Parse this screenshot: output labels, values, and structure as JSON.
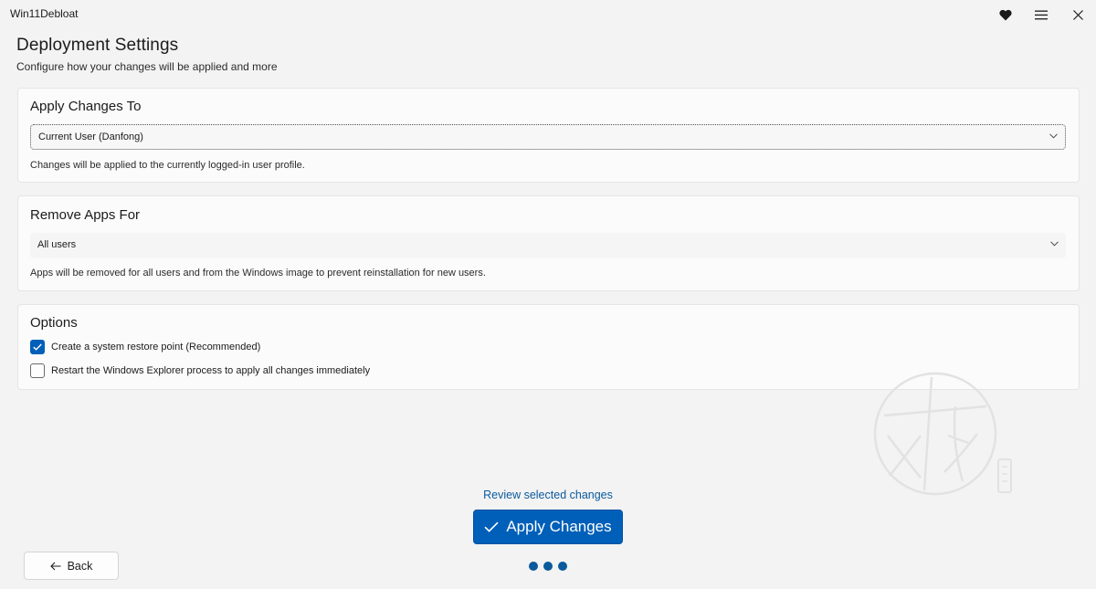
{
  "window": {
    "title": "Win11Debloat"
  },
  "titlebar": {
    "icons": [
      "heart-icon",
      "menu-icon",
      "close-icon"
    ]
  },
  "header": {
    "title": "Deployment Settings",
    "subtitle": "Configure how your changes will be applied and more"
  },
  "apply_changes": {
    "title": "Apply Changes To",
    "selected": "Current User (Danfong)",
    "description": "Changes will be applied to the currently logged-in user profile."
  },
  "remove_apps": {
    "title": "Remove Apps For",
    "selected": "All users",
    "description": "Apps will be removed for all users and from the Windows image to prevent reinstallation for new users."
  },
  "options": {
    "title": "Options",
    "items": [
      {
        "label": "Create a system restore point (Recommended)",
        "checked": true
      },
      {
        "label": "Restart the Windows Explorer process to apply all changes immediately",
        "checked": false
      }
    ]
  },
  "footer": {
    "review_link": "Review selected changes",
    "apply_label": "Apply Changes",
    "back_label": "Back",
    "progress_steps": 3
  },
  "colors": {
    "accent": "#005fb8",
    "link": "#0a5a9c",
    "background": "#f3f3f3",
    "card": "#fbfbfb"
  }
}
